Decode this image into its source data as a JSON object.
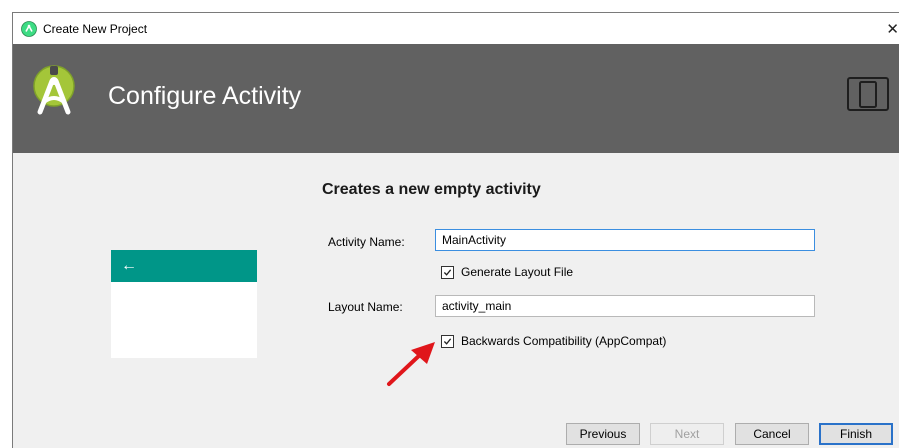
{
  "window": {
    "title": "Create New Project",
    "close_glyph": "✕"
  },
  "header": {
    "title": "Configure Activity",
    "logo_icon": "android-studio-icon",
    "device_icon": "phone-tablet-icon",
    "background": "#616161"
  },
  "content": {
    "title": "Creates a new empty activity",
    "preview": {
      "appbar_color": "#009688",
      "back_glyph": "←"
    },
    "activity_name": {
      "label": "Activity Name:",
      "value": "MainActivity"
    },
    "generate_layout": {
      "label": "Generate Layout File",
      "checked": true
    },
    "layout_name": {
      "label": "Layout Name:",
      "value": "activity_main"
    },
    "backwards_compat": {
      "label": "Backwards Compatibility (AppCompat)",
      "checked": true
    },
    "annotation_arrow_color": "#e0161b"
  },
  "buttons": {
    "previous": "Previous",
    "next": "Next",
    "cancel": "Cancel",
    "finish": "Finish"
  }
}
